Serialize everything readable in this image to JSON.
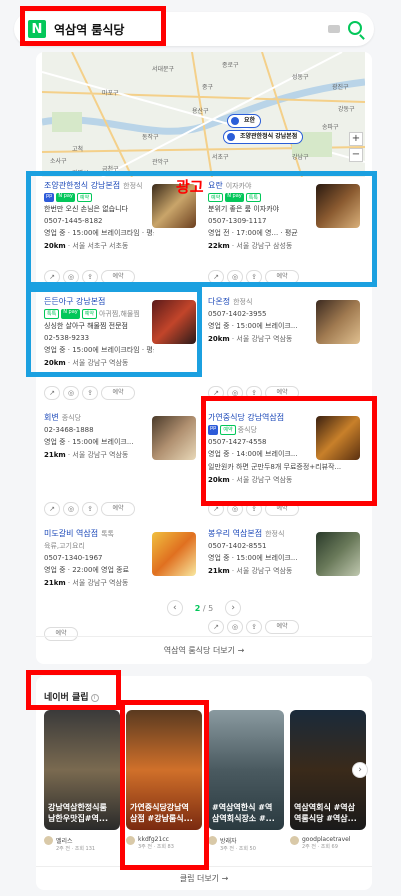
{
  "search": {
    "logo": "N",
    "query": "역삼역 룸식당"
  },
  "map": {
    "labels": [
      "서대문구",
      "종로구",
      "중구",
      "용산구",
      "마포구",
      "성동구",
      "광진구",
      "동작구",
      "서초구",
      "강남구",
      "송파구",
      "관악구",
      "금천구",
      "광명시",
      "소사구",
      "고척",
      "강동구"
    ],
    "pins": [
      "요한",
      "조양관한정식 강남본점"
    ],
    "zoom": [
      "+",
      "−"
    ]
  },
  "ad_label": "광고",
  "places": [
    {
      "name": "조양관한정식 강남본점",
      "category": "한정식",
      "badges": [
        "pp",
        "N pay",
        "예약"
      ],
      "desc": "한번만 오신 손님은 없습니다",
      "phone": "0507-1445-8182",
      "status": "영업 중 · 15:00에 브레이크타임 · 평균",
      "dist": "20km",
      "addr": "서울 서초구 서초동",
      "actions": [
        "↗",
        "◎",
        "⇪",
        "예약"
      ]
    },
    {
      "name": "요란",
      "category": "이자카야",
      "badges": [
        "예약",
        "N pay",
        "톡톡"
      ],
      "desc": "분위기 좋은 룸 이자카야",
      "phone": "0507-1309-1117",
      "status": "영업 전 · 17:00에 영... · 평균",
      "dist": "22km",
      "addr": "서울 강남구 삼성동",
      "actions": [
        "↗",
        "◎",
        "⇪",
        "예약"
      ]
    },
    {
      "name": "든든아구 강남본점",
      "category": "아귀찜,해물찜",
      "badges": [
        "톡톡",
        "N pay",
        "예약"
      ],
      "desc": "싱싱한 살아구 해물찜 전문점",
      "phone": "02-538-9233",
      "status": "영업 중 · 15:00에 브레이크타임 · 평균",
      "dist": "20km",
      "addr": "서울 강남구 역삼동",
      "actions": [
        "↗",
        "◎",
        "⇪",
        "예약"
      ]
    },
    {
      "name": "다온정",
      "category": "한정식",
      "badges": [],
      "desc": "",
      "phone": "0507-1402-3955",
      "status": "영업 중 · 15:00에 브레이크...",
      "dist": "20km",
      "addr": "서울 강남구 역삼동",
      "actions": [
        "↗",
        "◎",
        "⇪",
        "예약"
      ]
    },
    {
      "name": "회변",
      "category": "종식당",
      "badges": [],
      "desc": "",
      "phone": "02-3468-1888",
      "status": "영업 중 · 15:00에 브레이크...",
      "dist": "21km",
      "addr": "서울 강남구 역삼동",
      "actions": [
        "↗",
        "◎",
        "⇪",
        "예약"
      ]
    },
    {
      "name": "가연중식당 강남역삼점",
      "category": "중식당",
      "badges": [
        "pp",
        "예약"
      ],
      "desc": "",
      "phone": "0507-1427-4558",
      "status": "영업 중 · 14:00에 브레이크...",
      "extra": "일만원카 하면 군만두8개 무료증정+리뷰작...",
      "dist": "20km",
      "addr": "서울 강남구 역삼동",
      "actions": [
        "↗",
        "◎",
        "⇪",
        "예약"
      ]
    },
    {
      "name": "미도갈비 역삼점",
      "category": "톡톡",
      "badges": [],
      "desc": "육류,고기요리",
      "phone": "0507-1340-1967",
      "status": "영업 중 · 22:00에 영업 종료",
      "dist": "21km",
      "addr": "서울 강남구 역삼동",
      "actions": [
        "예약"
      ]
    },
    {
      "name": "봉우리 역삼본점",
      "category": "한정식",
      "badges": [],
      "desc": "",
      "phone": "0507-1402-8551",
      "status": "영업 중 · 15:00에 브레이크...",
      "dist": "21km",
      "addr": "서울 강남구 역삼동",
      "actions": [
        "↗",
        "◎",
        "⇪",
        "예약"
      ]
    }
  ],
  "pager": {
    "current": "2",
    "total": "/ 5",
    "prev": "‹",
    "next": "›"
  },
  "more_link": "역삼역 룸식당 더보기 →",
  "clips": {
    "title": "네이버 클립",
    "info": "i",
    "items": [
      {
        "caption": "강남역삼한정식룸 남한우맛집#역...",
        "author": "멜리스",
        "stat": "2주 전 · 조회 131"
      },
      {
        "caption": "가연중식당강남역 삼점 #강남룸식...",
        "author": "kkdfg21cc",
        "stat": "3주 전 · 조회 83"
      },
      {
        "caption": "#역삼역한식 #역 삼역회식장소 #...",
        "author": "방래자",
        "stat": "3주 전 · 조회 50"
      },
      {
        "caption": "역삼역회식 #역삼 역룸식당 #역삼...",
        "author": "goodplacetravel",
        "stat": "2주 전 · 조회 69"
      }
    ],
    "next": "›",
    "more": "클립 더보기 →"
  }
}
